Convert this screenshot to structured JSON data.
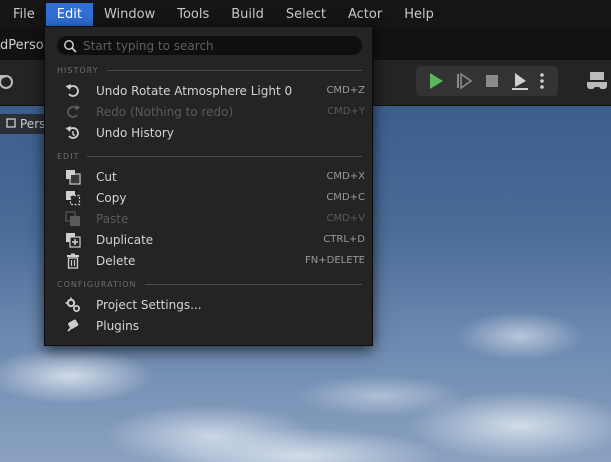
{
  "menubar": {
    "items": [
      {
        "label": "File",
        "active": false
      },
      {
        "label": "Edit",
        "active": true
      },
      {
        "label": "Window",
        "active": false
      },
      {
        "label": "Tools",
        "active": false
      },
      {
        "label": "Build",
        "active": false
      },
      {
        "label": "Select",
        "active": false
      },
      {
        "label": "Actor",
        "active": false
      },
      {
        "label": "Help",
        "active": false
      }
    ]
  },
  "level_tab": {
    "label": "dPerson"
  },
  "viewport": {
    "tab_label": "Persp"
  },
  "toolbar": {
    "icons": [
      "camera-icon",
      "play-icon",
      "step-forward-icon",
      "stop-icon",
      "eject-icon",
      "more-vertical-icon",
      "controller-icon"
    ],
    "play_color": "#5cb85c"
  },
  "dropdown": {
    "search_placeholder": "Start typing to search",
    "sections": [
      {
        "header": "HISTORY"
      },
      {
        "header": "EDIT"
      },
      {
        "header": "CONFIGURATION"
      }
    ],
    "history": [
      {
        "label": "Undo Rotate Atmosphere Light 0",
        "shortcut": "CMD+Z",
        "icon": "undo-icon",
        "enabled": true
      },
      {
        "label": "Redo (Nothing to redo)",
        "shortcut": "CMD+Y",
        "icon": "redo-icon",
        "enabled": false
      },
      {
        "label": "Undo History",
        "shortcut": "",
        "icon": "undo-history-icon",
        "enabled": true
      }
    ],
    "edit": [
      {
        "label": "Cut",
        "shortcut": "CMD+X",
        "icon": "cut-icon",
        "enabled": true
      },
      {
        "label": "Copy",
        "shortcut": "CMD+C",
        "icon": "copy-icon",
        "enabled": true
      },
      {
        "label": "Paste",
        "shortcut": "CMD+V",
        "icon": "paste-icon",
        "enabled": false
      },
      {
        "label": "Duplicate",
        "shortcut": "CTRL+D",
        "icon": "duplicate-icon",
        "enabled": true
      },
      {
        "label": "Delete",
        "shortcut": "FN+DELETE",
        "icon": "trash-icon",
        "enabled": true
      }
    ],
    "configuration": [
      {
        "label": "Project Settings...",
        "shortcut": "",
        "icon": "settings-icon",
        "enabled": true
      },
      {
        "label": "Plugins",
        "shortcut": "",
        "icon": "plugins-icon",
        "enabled": true
      }
    ]
  },
  "colors": {
    "accent": "#2f6fd6",
    "menu_bg": "#242424",
    "text": "#d4d4d4",
    "disabled_text": "#5a5a5a"
  }
}
